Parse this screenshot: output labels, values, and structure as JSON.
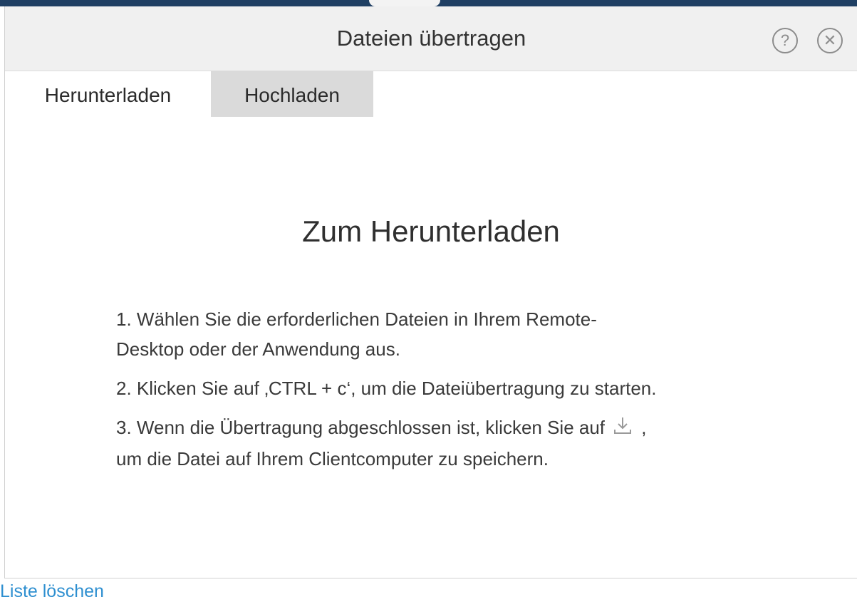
{
  "dialog": {
    "title": "Dateien übertragen",
    "help_icon": "question-circle-icon",
    "close_icon": "close-circle-icon"
  },
  "tabs": [
    {
      "label": "Herunterladen",
      "active": true
    },
    {
      "label": "Hochladen",
      "active": false
    }
  ],
  "content": {
    "heading": "Zum Herunterladen",
    "step1_line1": "1. Wählen Sie die erforderlichen Dateien in Ihrem Remote-",
    "step1_line2": "Desktop oder der Anwendung aus.",
    "step2": "2. Klicken Sie auf ‚CTRL + c‘, um die Dateiübertragung zu starten.",
    "step3_before": "3. Wenn die Übertragung abgeschlossen ist, klicken Sie auf",
    "step3_icon": "download-icon",
    "step3_after": ",",
    "step3_line2": "um die Datei auf Ihrem Clientcomputer zu speichern."
  },
  "footer": {
    "link_label": "Liste löschen"
  },
  "colors": {
    "top_strip": "#1f3f63",
    "link": "#2e8fd0",
    "inactive_tab": "#dadada",
    "titlebar": "#f0f0f0"
  }
}
